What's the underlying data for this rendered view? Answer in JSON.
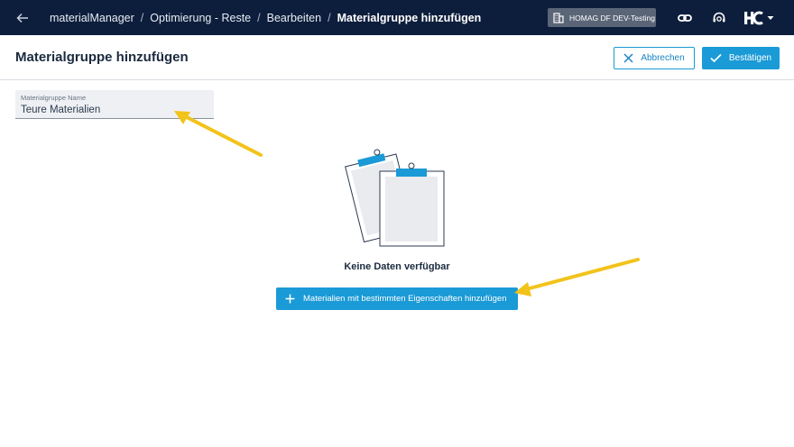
{
  "topbar": {
    "breadcrumb": [
      {
        "label": "materialManager"
      },
      {
        "label": "Optimierung - Reste"
      },
      {
        "label": "Bearbeiten"
      },
      {
        "label": "Materialgruppe hinzufügen"
      }
    ],
    "separator": "/",
    "tenant_label": "HOMAG DF DEV-Testing",
    "logo_text": "HC",
    "icons": [
      "back-arrow-icon",
      "building-icon",
      "link-icon",
      "support-agent-icon",
      "chevron-down-icon"
    ]
  },
  "header": {
    "title": "Materialgruppe hinzufügen",
    "cancel_label": "Abbrechen",
    "confirm_label": "Bestätigen"
  },
  "form": {
    "name_label": "Materialgruppe Name",
    "name_value": "Teure Materialien"
  },
  "empty_state": {
    "message": "Keine Daten verfügbar",
    "add_button_label": "Materialien mit bestimmten Eigenschaften hinzufügen"
  },
  "colors": {
    "topbar_bg": "#0d1e3c",
    "accent": "#1a9ad6",
    "annotation_arrow": "#f2c31b"
  }
}
